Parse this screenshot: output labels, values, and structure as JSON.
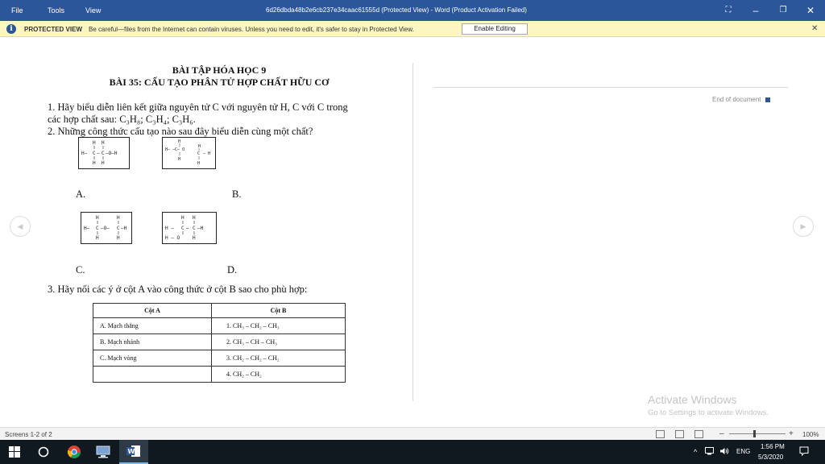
{
  "titlebar": {
    "menu": [
      "File",
      "Tools",
      "View"
    ],
    "title": "6d26dbda48b2e6cb237e34caac61555d (Protected View) - Word (Product Activation Failed)",
    "controls": {
      "fullscreen": "⛶",
      "minimize": "–",
      "restore": "❐",
      "close": "✕"
    }
  },
  "protected_view": {
    "icon": "i",
    "label": "PROTECTED VIEW",
    "message": "Be careful—files from the Internet can contain viruses. Unless you need to edit, it's safer to stay in Protected View.",
    "button": "Enable Editing",
    "close": "✕"
  },
  "document": {
    "title1": "BÀI TẬP HÓA HỌC 9",
    "title2": "BÀI 35: CẤU TẠO PHÂN TỬ HỢP CHẤT HỮU CƠ",
    "q1_line1": "1. Hãy biểu diễn liên kết giữa nguyên tử C với nguyên tử H, C với C trong",
    "q1_line2": "các hợp chất sau: C₃H₈; C₃H₄; C₃H₆.",
    "q2": "2. Những công thức cấu tạo nào sau đây biểu diễn cùng một chất?",
    "options": {
      "a": "A.",
      "b": "B.",
      "c": "C.",
      "d": "D."
    },
    "q3": "3. Hãy nối các ý ở cột A vào công thức ở cột B sao cho phù hợp:",
    "table": {
      "header_a": "Cột A",
      "header_b": "Cột B",
      "rows": [
        {
          "a": "A. Mạch thẳng",
          "b": "1.  CH₃ – CH₂ – CH₃"
        },
        {
          "a": "B. Mạch nhánh",
          "b": "2.  CH₃ – CH – CH₃"
        },
        {
          "a": "C. Mạch vòng",
          "b": "3.  CH₂ – CH₂ – CH₂"
        },
        {
          "a": "",
          "b": "4.  CH₂  –  CH₂"
        }
      ]
    },
    "end_of_document": "End of document"
  },
  "watermark": {
    "line1": "Activate Windows",
    "line2": "Go to Settings to activate Windows."
  },
  "statusbar": {
    "screens": "Screens 1-2 of 2",
    "zoom_minus": "–",
    "zoom_plus": "+",
    "zoom": "100%"
  },
  "taskbar": {
    "language": "ENG",
    "time": "1:56 PM",
    "date": "5/3/2020",
    "tray_chevron": "^"
  },
  "colors": {
    "accent": "#2b579a",
    "protected_bar": "#fdf6c2",
    "taskbar": "#101820"
  }
}
